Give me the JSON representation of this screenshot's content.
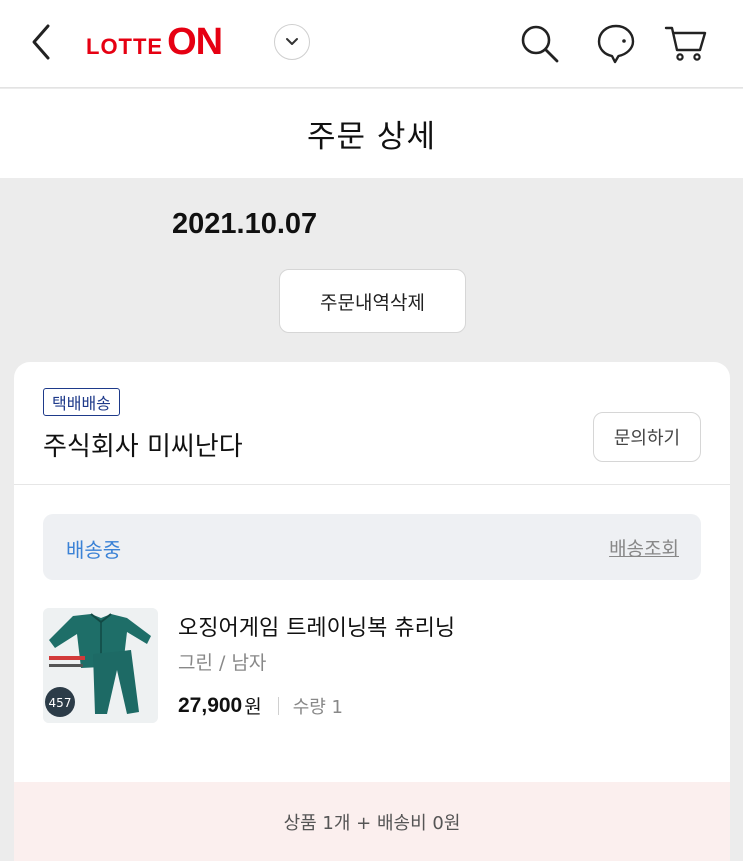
{
  "header": {
    "logo_lotte": "LOTTE",
    "logo_on": "ON",
    "brand_color": "#e60012",
    "icons": [
      "back-arrow-icon",
      "chevron-down-icon",
      "search-icon",
      "chat-bubble-icon",
      "cart-icon"
    ]
  },
  "page": {
    "title": "주문 상세"
  },
  "order": {
    "date": "2021.10.07",
    "delete_label": "주문내역삭제"
  },
  "card": {
    "delivery_tag": "택배배송",
    "seller": "주식회사 미씨난다",
    "inquiry_label": "문의하기",
    "status": "배송중",
    "status_color": "#3b82d6",
    "track_label": "배송조회",
    "product": {
      "name": "오징어게임 트레이닝복 츄리닝",
      "option": "그린 / 남자",
      "price": "27,900",
      "price_unit": "원",
      "quantity": "수량 1",
      "image_badge": "457"
    },
    "summary": "상품 1개 + 배송비 0원"
  }
}
